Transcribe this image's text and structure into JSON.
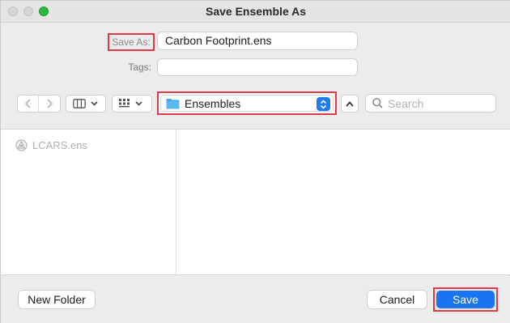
{
  "window": {
    "title": "Save Ensemble As"
  },
  "form": {
    "save_as_label": "Save As:",
    "file_name": "Carbon Footprint.ens",
    "tags_label": "Tags:",
    "tags_value": ""
  },
  "toolbar": {
    "location": "Ensembles",
    "search_placeholder": "Search"
  },
  "browser": {
    "files": [
      {
        "name": "LCARS.ens"
      }
    ]
  },
  "footer": {
    "new_folder_label": "New Folder",
    "cancel_label": "Cancel",
    "save_label": "Save"
  },
  "colors": {
    "accent": "#1a73f0",
    "highlight_border": "#e13a46",
    "maximize": "#29b940"
  },
  "icons": [
    "chevron-left-icon",
    "chevron-right-icon",
    "columns-view-icon",
    "chevron-down-icon",
    "icon-grid-icon",
    "folder-icon",
    "up-down-stepper-icon",
    "chevron-up-icon",
    "magnifier-icon",
    "document-icon"
  ]
}
